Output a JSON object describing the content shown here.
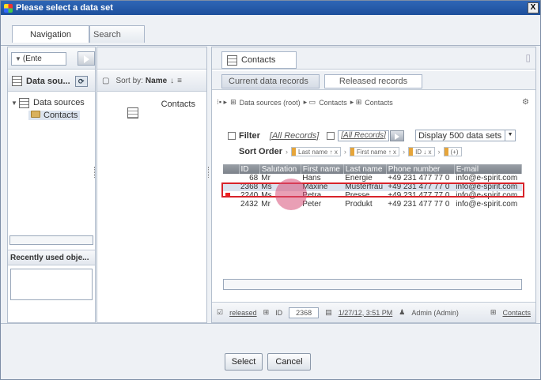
{
  "window": {
    "title": "Please select a data set",
    "close": "X"
  },
  "top_tabs": [
    "Navigation",
    "Search"
  ],
  "nav": {
    "combo_value": "(Ente",
    "panel_title": "Data sou...",
    "tree": [
      {
        "label": "Data sources"
      },
      {
        "label": "Contacts"
      }
    ],
    "recent_title": "Recently used obje..."
  },
  "middle": {
    "sort_by_label": "Sort by:",
    "sort_by_value": "Name",
    "item_label": "Contacts"
  },
  "content": {
    "tab_label": "Contacts",
    "subtabs": [
      "Current data records",
      "Released records"
    ],
    "breadcrumb": [
      "Data sources (root)",
      "Contacts",
      "Contacts"
    ],
    "filter_label": "Filter",
    "filter_link": "[All Records]",
    "filter_search": "[All Records]",
    "display_label": "Display 500 data sets",
    "sort_order_label": "Sort Order",
    "sort_chips": [
      "Last name  ↑ x",
      "First name  ↑ x",
      "ID  ↓ x",
      "(+)"
    ],
    "table": {
      "headers": [
        "ID",
        "Salutation",
        "First name",
        "Last name",
        "Phone number",
        "E-mail"
      ],
      "rows": [
        [
          "68",
          "Mr",
          "Hans",
          "Energie",
          "+49 231 477 77 0",
          "info@e-spirit.com"
        ],
        [
          "2368",
          "Ms",
          "Maxine",
          "Musterfrau",
          "+49 231 477 77 0",
          "info@e-spirit.com"
        ],
        [
          "2240",
          "Ms",
          "Petra",
          "Presse",
          "+49 231 477 77 0",
          "info@e-spirit.com"
        ],
        [
          "2432",
          "Mr",
          "Peter",
          "Produkt",
          "+49 231 477 77 0",
          "info@e-spirit.com"
        ]
      ]
    },
    "status": {
      "released": "released",
      "id_label": "ID",
      "id_value": "2368",
      "date": "1/27/12, 3:51 PM",
      "user": "Admin (Admin)",
      "table_link": "Contacts"
    }
  },
  "buttons": {
    "select": "Select",
    "cancel": "Cancel"
  }
}
